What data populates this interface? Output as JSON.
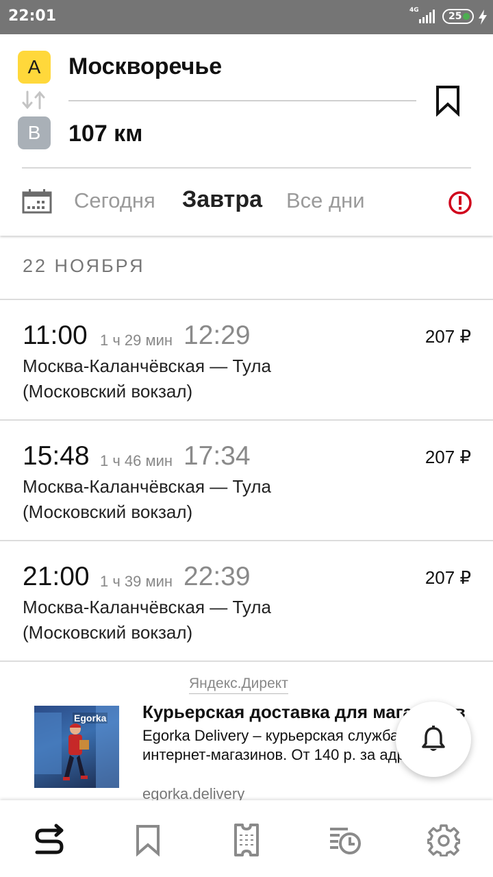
{
  "status_bar": {
    "time": "22:01",
    "network": "4G",
    "battery": "25"
  },
  "route": {
    "point_a_badge": "A",
    "point_b_badge": "B",
    "from": "Москворечье",
    "to": "107 км"
  },
  "day_tabs": {
    "today": "Сегодня",
    "tomorrow": "Завтра",
    "all_days": "Все дни",
    "selected": "Завтра"
  },
  "date_header": "22 НОЯБРЯ",
  "trips": [
    {
      "departure": "11:00",
      "duration": "1 ч 29 мин",
      "arrival": "12:29",
      "price": "207 ₽",
      "route_line1": "Москва-Каланчёвская — Тула",
      "route_line2": "(Московский вокзал)"
    },
    {
      "departure": "15:48",
      "duration": "1 ч 46 мин",
      "arrival": "17:34",
      "price": "207 ₽",
      "route_line1": "Москва-Каланчёвская — Тула",
      "route_line2": "(Московский вокзал)"
    },
    {
      "departure": "21:00",
      "duration": "1 ч 39 мин",
      "arrival": "22:39",
      "price": "207 ₽",
      "route_line1": "Москва-Каланчёвская — Тула",
      "route_line2": "(Московский вокзал)"
    }
  ],
  "ad": {
    "label": "Яндекс.Директ",
    "image_brand": "Egorka",
    "title": "Курьерская доставка для магазинов",
    "text": "Egorka Delivery – курьерская служба для интернет-магазинов. От 140 р. за адрес.",
    "domain": "egorka.delivery"
  },
  "bottom_nav": {
    "items": [
      "routes-icon",
      "bookmark-icon",
      "ticket-icon",
      "history-icon",
      "settings-icon"
    ]
  },
  "colors": {
    "point_a": "#ffd83b",
    "point_b": "#a9b0b7",
    "alert": "#d0021b"
  }
}
